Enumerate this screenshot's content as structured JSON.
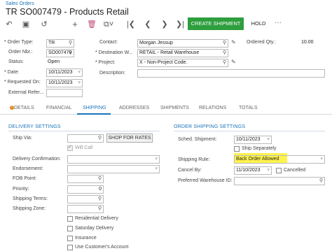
{
  "header": {
    "breadcrumb": "Sales Orders",
    "title": "TR SO007479 - Products Retail"
  },
  "toolbar": {
    "icons": [
      "undo-icon",
      "save-icon",
      "cancel-icon",
      "add-icon",
      "delete-icon",
      "copy-icon",
      "first-icon",
      "prev-icon",
      "next-icon",
      "last-icon"
    ],
    "create_shipment": "CREATE SHIPMENT",
    "hold": "HOLD",
    "more": "···"
  },
  "summary": {
    "order_type_label": "Order Type:",
    "order_type": "TR",
    "order_nbr_label": "Order Nbr.:",
    "order_nbr": "SO007479",
    "status_label": "Status:",
    "status": "Open",
    "date_label": "Date:",
    "date": "10/11/2023",
    "requested_on_label": "Requested On:",
    "requested_on": "10/11/2023",
    "external_ref_label": "External Refer...",
    "external_ref": "",
    "contact_label": "Contact:",
    "contact": "Morgan Jessup",
    "dest_wh_label": "Destination W...",
    "dest_wh": "RETAIL - Retail Warehouse",
    "project_label": "Project:",
    "project": "X - Non-Project Code.",
    "description_label": "Description:",
    "description": "",
    "ordered_qty_label": "Ordered Qty.:",
    "ordered_qty": "10.00"
  },
  "tabs": [
    {
      "label": "DETAILS"
    },
    {
      "label": "FINANCIAL"
    },
    {
      "label": "SHIPPING"
    },
    {
      "label": "ADDRESSES"
    },
    {
      "label": "SHIPMENTS"
    },
    {
      "label": "RELATIONS"
    },
    {
      "label": "TOTALS"
    }
  ],
  "delivery": {
    "title": "DELIVERY SETTINGS",
    "ship_via_label": "Ship Via:",
    "ship_via": "",
    "shop_rates": "SHOP FOR RATES",
    "will_call": "Will Call",
    "delivery_conf_label": "Delivery Confirmation:",
    "delivery_conf": "",
    "endorsement_label": "Endorsement:",
    "endorsement": "",
    "fob_label": "FOB Point:",
    "fob": "",
    "priority_label": "Priority:",
    "priority": "0",
    "shipping_terms_label": "Shipping Terms:",
    "shipping_terms": "",
    "shipping_zone_label": "Shipping Zone:",
    "shipping_zone": "",
    "residential": "Residential Delivery",
    "saturday": "Saturday Delivery",
    "insurance": "Insurance",
    "use_customer_account": "Use Customer's Account"
  },
  "order_shipping": {
    "title": "ORDER SHIPPING SETTINGS",
    "sched_shipment_label": "Sched. Shipment:",
    "sched_shipment": "10/11/2023",
    "ship_separately": "Ship Separately",
    "shipping_rule_label": "Shipping Rule:",
    "shipping_rule": "Back Order Allowed",
    "cancel_by_label": "Cancel By:",
    "cancel_by": "11/10/2023",
    "cancelled": "Cancelled",
    "pref_wh_label": "Preferred Warehouse ID:",
    "pref_wh": ""
  },
  "colors": {
    "accent": "#1a73b8",
    "create_button": "#2e9e3e",
    "highlight": "#fff12e"
  }
}
